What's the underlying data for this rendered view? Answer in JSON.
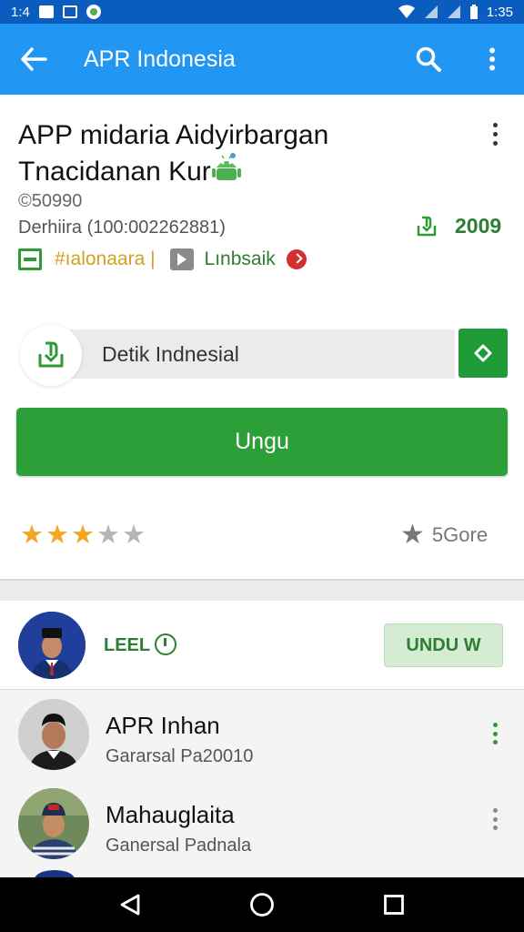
{
  "status_bar": {
    "time_left": "1:4",
    "time_right": "1:35"
  },
  "app_bar": {
    "title": "APR Indonesia",
    "back_icon": "arrow-left-icon",
    "search_icon": "search-icon",
    "menu_icon": "more-vert-icon"
  },
  "app": {
    "title": "APP midaria Aidyirbargan Tnacidanan Kur",
    "copyright": "©50990",
    "developer_line": "Derhiira (100:002262881)",
    "downloads": "2009",
    "tag_label": "#ıalonaara |",
    "link_label": "Lınbsaik"
  },
  "search": {
    "value": "Detik Indnesial"
  },
  "install": {
    "label": "Ungu"
  },
  "rating": {
    "stars_filled": 3,
    "stars_total": 5,
    "score_label": "5Gore"
  },
  "featured": {
    "label": "LEEL",
    "button_label": "UNDU W"
  },
  "list": [
    {
      "name": "APR Inhan",
      "subtitle": "Gararsal Pa20010",
      "menu_color": "#2e9c35"
    },
    {
      "name": "Mahauglaita",
      "subtitle": "Ganersal Padnala",
      "menu_color": "#8a8a8a"
    }
  ],
  "colors": {
    "primary": "#2196f3",
    "accent_green": "#2d9f38",
    "star": "#f5a623"
  }
}
